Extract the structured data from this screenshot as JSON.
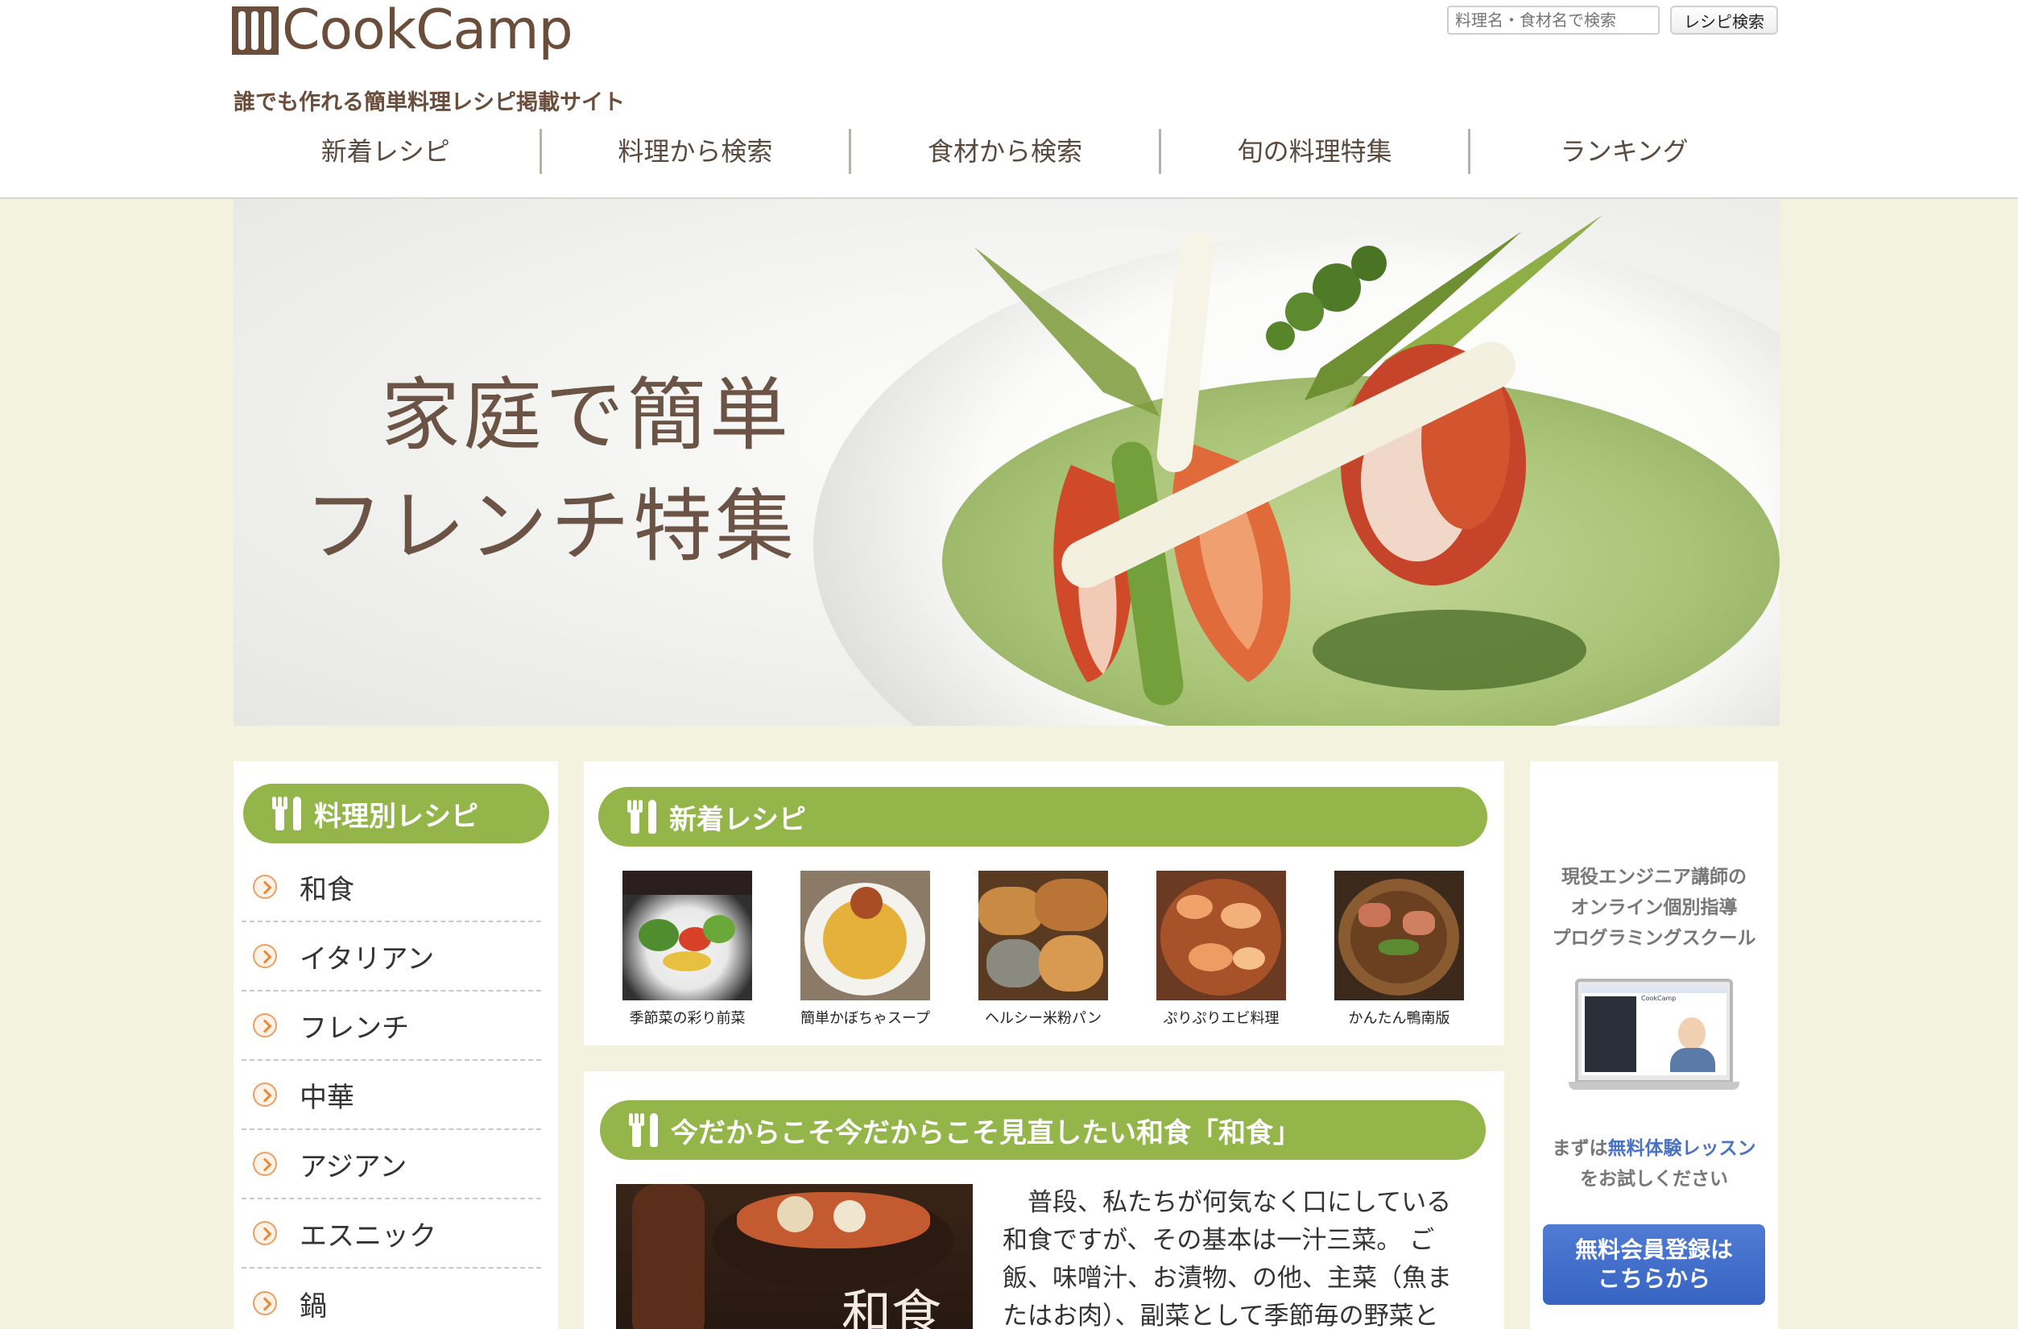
{
  "header": {
    "logo_text": "CookCamp",
    "tagline": "誰でも作れる簡単料理レシピ掲載サイト",
    "search_placeholder": "料理名・食材名で検索",
    "search_button": "レシピ検索"
  },
  "nav": {
    "items": [
      {
        "label": "新着レシピ"
      },
      {
        "label": "料理から検索"
      },
      {
        "label": "食材から検索"
      },
      {
        "label": "旬の料理特集"
      },
      {
        "label": "ランキング"
      }
    ]
  },
  "hero": {
    "line1": "家庭で簡単",
    "line2": "フレンチ特集"
  },
  "sidebar": {
    "title": "料理別レシピ",
    "items": [
      {
        "label": "和食"
      },
      {
        "label": "イタリアン"
      },
      {
        "label": "フレンチ"
      },
      {
        "label": "中華"
      },
      {
        "label": "アジアン"
      },
      {
        "label": "エスニック"
      },
      {
        "label": "鍋"
      }
    ]
  },
  "new_recipes": {
    "title": "新着レシピ",
    "items": [
      {
        "caption": "季節菜の彩り前菜"
      },
      {
        "caption": "簡単かぼちゃスープ"
      },
      {
        "caption": "ヘルシー米粉パン"
      },
      {
        "caption": "ぷりぷりエビ料理"
      },
      {
        "caption": "かんたん鴨南版"
      }
    ]
  },
  "feature": {
    "title": "今だからこそ今だからこそ見直したい和食「和食」",
    "image_label": "和食",
    "body": "普段、私たちが何気なく口にしている和食ですが、その基本は一汁三菜。 ご飯、味噌汁、お漬物、の他、主菜（魚またはお肉）、副菜として季節毎の野菜と"
  },
  "ad": {
    "line1": "現役エンジニア講師の",
    "line2": "オンライン個別指導",
    "line3": "プログラミングスクール",
    "trial_prefix": "まずは",
    "trial_highlight": "無料体験レッスン",
    "trial_suffix": "をお試しください",
    "button_line1": "無料会員登録は",
    "button_line2": "こちらから",
    "screen_brand": "CookCamp"
  },
  "colors": {
    "accent_green": "#94b54a",
    "brown": "#6a4d3a",
    "page_bg": "#f3f2de",
    "ad_button": "#3f6cc9"
  }
}
